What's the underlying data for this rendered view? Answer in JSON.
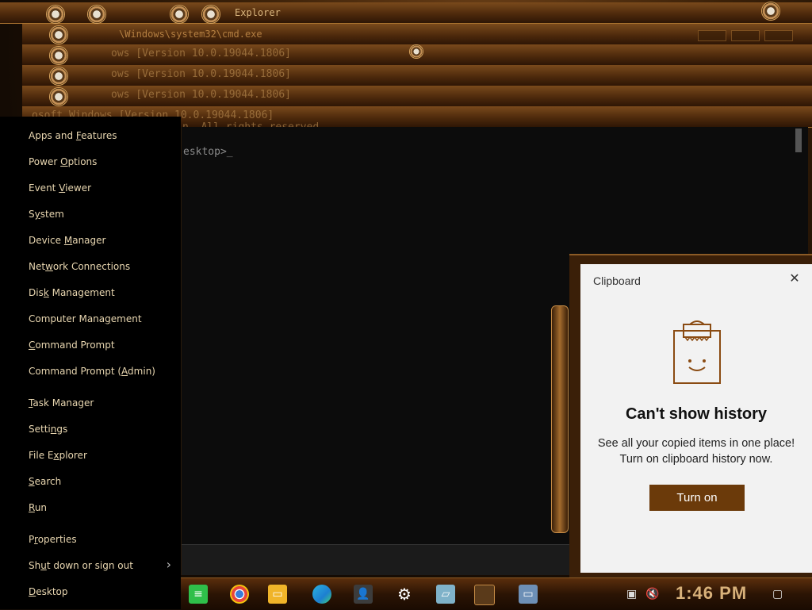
{
  "background": {
    "explorer_title": "Explorer",
    "cmd_title": "\\Windows\\system32\\cmd.exe",
    "version_lines": [
      "ows [Version 10.0.19044.1806]",
      "ows [Version 10.0.19044.1806]",
      "ows [Version 10.0.19044.1806]",
      "osoft Windows [Version 10.0.19044.1806]"
    ],
    "rights_line": "n. All rights reserved.",
    "prompt": "esktop>_"
  },
  "winx_menu": {
    "items": [
      {
        "pre": "Apps and ",
        "key": "F",
        "post": "eatures"
      },
      {
        "pre": "Power ",
        "key": "O",
        "post": "ptions"
      },
      {
        "pre": "Event ",
        "key": "V",
        "post": "iewer"
      },
      {
        "pre": "S",
        "key": "y",
        "post": "stem"
      },
      {
        "pre": "Device ",
        "key": "M",
        "post": "anager"
      },
      {
        "pre": "Net",
        "key": "w",
        "post": "ork Connections"
      },
      {
        "pre": "Dis",
        "key": "k",
        "post": " Management"
      },
      {
        "pre": "Computer Mana",
        "key": "g",
        "post": "ement"
      },
      {
        "pre": "",
        "key": "C",
        "post": "ommand Prompt"
      },
      {
        "pre": "Command Prompt (",
        "key": "A",
        "post": "dmin)"
      },
      {
        "pre": "",
        "key": "T",
        "post": "ask Manager"
      },
      {
        "pre": "Setti",
        "key": "n",
        "post": "gs"
      },
      {
        "pre": "File E",
        "key": "x",
        "post": "plorer"
      },
      {
        "pre": "",
        "key": "S",
        "post": "earch"
      },
      {
        "pre": "",
        "key": "R",
        "post": "un"
      },
      {
        "pre": "P",
        "key": "r",
        "post": "operties"
      },
      {
        "pre": "Sh",
        "key": "u",
        "post": "t down or sign out"
      },
      {
        "pre": "",
        "key": "D",
        "post": "esktop"
      }
    ],
    "submenu_arrow": "›"
  },
  "clipboard": {
    "title": "Clipboard",
    "close_glyph": "✕",
    "heading": "Can't show history",
    "line1": "See all your copied items in one place!",
    "line2": "Turn on clipboard history now.",
    "button": "Turn on",
    "accent": "#6b3a0a"
  },
  "taskbar": {
    "clock": "1:46 PM",
    "icons": [
      "notes-icon",
      "chrome-icon",
      "file-explorer-icon",
      "edge-icon",
      "people-icon",
      "settings-gear-icon",
      "notepad-icon",
      "app-tile-icon",
      "laptop-icon"
    ]
  }
}
